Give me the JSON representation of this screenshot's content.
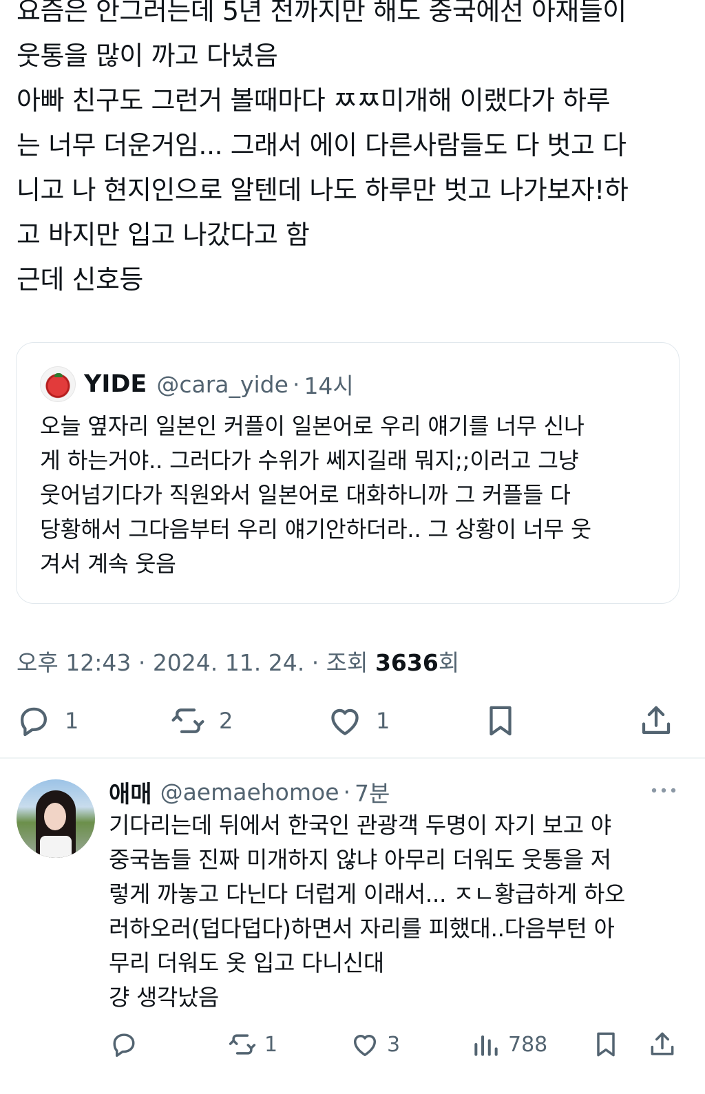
{
  "main_tweet": {
    "lines": [
      "요즘은 안그러는데 5년 전까지만 해도 중국에선 아재들이",
      "웃통을 많이 까고 다녔음",
      "아빠 친구도 그런거 볼때마다 ㅉㅉ미개해 이랬다가 하루",
      "는 너무 더운거임... 그래서 에이 다른사람들도 다 벗고 다",
      "니고 나 현지인으로 알텐데 나도 하루만 벗고 나가보자!하",
      "고 바지만 입고 나갔다고 함",
      "근데 신호등"
    ]
  },
  "quote": {
    "avatar_icon": "tomato-icon",
    "name": "YIDE",
    "handle": "@cara_yide",
    "separator": "·",
    "time": "14시",
    "lines": [
      "오늘 옆자리 일본인 커플이 일본어로 우리 얘기를 너무 신나",
      "게 하는거야.. 그러다가 수위가 쎄지길래 뭐지;;이러고 그냥",
      "웃어넘기다가 직원와서 일본어로 대화하니까 그 커플들 다",
      "당황해서 그다음부터 우리 얘기안하더라.. 그 상황이 너무 웃",
      "겨서 계속 웃음"
    ]
  },
  "meta": {
    "time": "오후 12:43",
    "sep1": "·",
    "date": "2024. 11. 24.",
    "sep2": "·",
    "views_label": "조회",
    "views_count": "3636",
    "views_suffix": "회"
  },
  "actions": {
    "reply_count": "1",
    "retweet_count": "2",
    "like_count": "1"
  },
  "reply": {
    "name": "애매",
    "handle": "@aemaehomoe",
    "separator": "·",
    "time": "7분",
    "lines": [
      "기다리는데 뒤에서 한국인 관광객 두명이 자기 보고 야",
      "중국놈들 진짜 미개하지 않냐 아무리 더워도 웃통을 저",
      "렇게 까놓고 다닌다 더럽게 이래서... ㅈㄴ황급하게 하오",
      "러하오러(덥다덥다)하면서 자리를 피했대..다음부턴 아",
      "무리 더워도 옷 입고 다니신대",
      "걍 생각났음"
    ],
    "actions": {
      "reply_count": "",
      "retweet_count": "1",
      "like_count": "3",
      "views_count": "788"
    }
  },
  "colors": {
    "text": "#0f1419",
    "secondary": "#536471",
    "border": "#e1e8ed"
  }
}
